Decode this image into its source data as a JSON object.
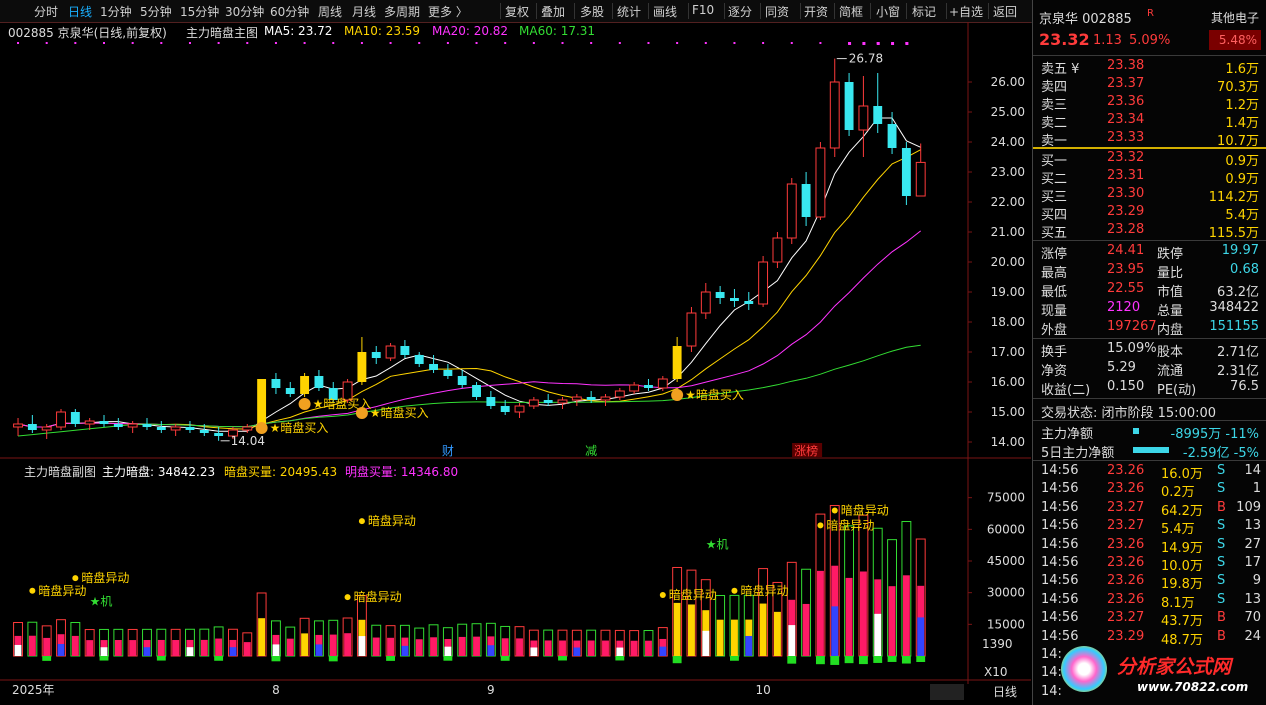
{
  "toolbar": {
    "items": [
      "分时",
      "日线",
      "1分钟",
      "5分钟",
      "15分钟",
      "30分钟",
      "60分钟",
      "周线",
      "月线",
      "多周期",
      "更多 〉",
      "复权",
      "叠加",
      "多股",
      "统计",
      "画线",
      "F10",
      "逐分",
      "同资",
      "开资",
      "简框",
      "小窗",
      "标记",
      "+自选",
      "返回"
    ],
    "active": "日线"
  },
  "main_chart": {
    "header": {
      "code_name": "002885 京泉华(日线,前复权)",
      "indicator": "主力暗盘主图",
      "ma5": "MA5: 23.72",
      "ma10": "MA10: 23.59",
      "ma20": "MA20: 20.82",
      "ma60": "MA60: 17.31"
    },
    "high_label": "26.78",
    "low_label": "14.04",
    "buy_signal_text": "★暗盘买入",
    "event_tags": [
      "财",
      "减",
      "涨榜"
    ],
    "y_ticks": [
      "26.00",
      "25.00",
      "24.00",
      "23.00",
      "22.00",
      "21.00",
      "20.00",
      "19.00",
      "18.00",
      "17.00",
      "16.00",
      "15.00",
      "14.00"
    ]
  },
  "sub_chart": {
    "indicator": "主力暗盘副图",
    "main_value": "主力暗盘: 34842.23",
    "dark_buy": "暗盘买量: 20495.43",
    "bright_buy": "明盘买量: 14346.80",
    "anomaly_text": "暗盘异动",
    "machine_text": "★机",
    "y_ticks": [
      "75000",
      "60000",
      "45000",
      "30000",
      "15000"
    ],
    "vol_box": "1390",
    "x10": "X10"
  },
  "x_axis": {
    "labels": [
      "2025年",
      "8",
      "9",
      "10"
    ],
    "bottom_right": "日线"
  },
  "chart_data": {
    "type": "candlestick",
    "title": "002885 京泉华(日线,前复权)",
    "ylim": [
      13.6,
      27.2
    ],
    "x_labels": [
      "2025年",
      "8",
      "9",
      "10"
    ],
    "ohlc": [
      [
        14.5,
        14.8,
        14.2,
        14.6
      ],
      [
        14.6,
        14.9,
        14.3,
        14.4
      ],
      [
        14.4,
        14.6,
        14.1,
        14.5
      ],
      [
        14.5,
        15.1,
        14.4,
        15.0
      ],
      [
        15.0,
        15.1,
        14.5,
        14.6
      ],
      [
        14.6,
        14.8,
        14.4,
        14.7
      ],
      [
        14.7,
        14.9,
        14.5,
        14.6
      ],
      [
        14.6,
        14.8,
        14.4,
        14.5
      ],
      [
        14.5,
        14.7,
        14.3,
        14.6
      ],
      [
        14.6,
        14.8,
        14.4,
        14.5
      ],
      [
        14.5,
        14.7,
        14.3,
        14.4
      ],
      [
        14.4,
        14.6,
        14.2,
        14.5
      ],
      [
        14.5,
        14.7,
        14.3,
        14.4
      ],
      [
        14.4,
        14.6,
        14.2,
        14.3
      ],
      [
        14.3,
        14.5,
        14.04,
        14.2
      ],
      [
        14.2,
        14.5,
        14.1,
        14.4
      ],
      [
        14.4,
        14.6,
        14.3,
        14.5
      ],
      [
        14.5,
        16.1,
        14.5,
        16.1
      ],
      [
        16.1,
        16.3,
        15.6,
        15.8
      ],
      [
        15.8,
        16.0,
        15.5,
        15.6
      ],
      [
        15.6,
        16.3,
        15.5,
        16.2
      ],
      [
        16.2,
        16.4,
        15.7,
        15.8
      ],
      [
        15.8,
        16.0,
        15.3,
        15.4
      ],
      [
        15.4,
        16.1,
        15.3,
        16.0
      ],
      [
        16.0,
        17.5,
        15.9,
        17.0
      ],
      [
        17.0,
        17.2,
        16.6,
        16.8
      ],
      [
        16.8,
        17.3,
        16.7,
        17.2
      ],
      [
        17.2,
        17.4,
        16.8,
        16.9
      ],
      [
        16.9,
        17.0,
        16.5,
        16.6
      ],
      [
        16.6,
        16.9,
        16.3,
        16.4
      ],
      [
        16.4,
        16.6,
        16.1,
        16.2
      ],
      [
        16.2,
        16.4,
        15.8,
        15.9
      ],
      [
        15.9,
        16.0,
        15.4,
        15.5
      ],
      [
        15.5,
        15.7,
        15.1,
        15.2
      ],
      [
        15.2,
        15.4,
        14.9,
        15.0
      ],
      [
        15.0,
        15.3,
        14.8,
        15.2
      ],
      [
        15.2,
        15.5,
        15.1,
        15.4
      ],
      [
        15.4,
        15.6,
        15.2,
        15.3
      ],
      [
        15.3,
        15.5,
        15.1,
        15.4
      ],
      [
        15.4,
        15.6,
        15.2,
        15.5
      ],
      [
        15.5,
        15.7,
        15.3,
        15.4
      ],
      [
        15.4,
        15.6,
        15.2,
        15.5
      ],
      [
        15.5,
        15.8,
        15.4,
        15.7
      ],
      [
        15.7,
        16.0,
        15.6,
        15.9
      ],
      [
        15.9,
        16.1,
        15.7,
        15.8
      ],
      [
        15.8,
        16.2,
        15.7,
        16.1
      ],
      [
        16.1,
        17.5,
        16.0,
        17.2
      ],
      [
        17.2,
        18.5,
        17.0,
        18.3
      ],
      [
        18.3,
        19.3,
        18.1,
        19.0
      ],
      [
        19.0,
        19.2,
        18.6,
        18.8
      ],
      [
        18.8,
        19.1,
        18.5,
        18.7
      ],
      [
        18.7,
        19.0,
        18.4,
        18.6
      ],
      [
        18.6,
        20.2,
        18.5,
        20.0
      ],
      [
        20.0,
        21.0,
        19.8,
        20.8
      ],
      [
        20.8,
        22.8,
        20.6,
        22.6
      ],
      [
        22.6,
        23.0,
        21.2,
        21.5
      ],
      [
        21.5,
        24.0,
        21.4,
        23.8
      ],
      [
        23.8,
        26.78,
        23.5,
        26.0
      ],
      [
        26.0,
        26.3,
        24.2,
        24.4
      ],
      [
        24.4,
        26.2,
        23.5,
        25.2
      ],
      [
        25.2,
        26.3,
        24.3,
        24.6
      ],
      [
        24.6,
        25.0,
        23.6,
        23.8
      ],
      [
        23.8,
        24.0,
        21.9,
        22.2
      ],
      [
        22.2,
        23.95,
        22.55,
        23.32
      ]
    ],
    "ma": [
      {
        "name": "MA5",
        "last": 23.72
      },
      {
        "name": "MA10",
        "last": 23.59
      },
      {
        "name": "MA20",
        "last": 20.82
      },
      {
        "name": "MA60",
        "last": 17.31
      }
    ]
  },
  "panel": {
    "name_code": "京泉华 002885",
    "r_badge": "R",
    "sector": "其他电子",
    "sector_pct": "5.48%",
    "price": "23.32",
    "change": "1.13",
    "change_pct": "5.09%",
    "asks": [
      {
        "label": "卖五 ¥",
        "price": "23.38",
        "vol": "1.6万"
      },
      {
        "label": "卖四",
        "price": "23.37",
        "vol": "70.3万"
      },
      {
        "label": "卖三",
        "price": "23.36",
        "vol": "1.2万"
      },
      {
        "label": "卖二",
        "price": "23.34",
        "vol": "1.4万"
      },
      {
        "label": "卖一",
        "price": "23.33",
        "vol": "10.7万"
      }
    ],
    "bids": [
      {
        "label": "买一",
        "price": "23.32",
        "vol": "0.9万"
      },
      {
        "label": "买二",
        "price": "23.31",
        "vol": "0.9万"
      },
      {
        "label": "买三",
        "price": "23.30",
        "vol": "114.2万"
      },
      {
        "label": "买四",
        "price": "23.29",
        "vol": "5.4万"
      },
      {
        "label": "买五",
        "price": "23.28",
        "vol": "115.5万"
      }
    ],
    "stats": [
      {
        "l1": "涨停",
        "v1": "24.41",
        "c1": "red",
        "l2": "跌停",
        "v2": "19.97",
        "c2": "green"
      },
      {
        "l1": "最高",
        "v1": "23.95",
        "c1": "red",
        "l2": "量比",
        "v2": "0.68",
        "c2": "green"
      },
      {
        "l1": "最低",
        "v1": "22.55",
        "c1": "red",
        "l2": "市值",
        "v2": "63.2亿",
        "c2": "white"
      },
      {
        "l1": "现量",
        "v1": "2120",
        "c1": "magenta",
        "l2": "总量",
        "v2": "348422",
        "c2": "white"
      },
      {
        "l1": "外盘",
        "v1": "197267",
        "c1": "red",
        "l2": "内盘",
        "v2": "151155",
        "c2": "green"
      }
    ],
    "stats2": [
      {
        "l1": "换手",
        "v1": "15.09%",
        "l2": "股本",
        "v2": "2.71亿"
      },
      {
        "l1": "净资",
        "v1": "5.29",
        "l2": "流通",
        "v2": "2.31亿"
      },
      {
        "l1": "收益(二)",
        "v1": "0.150",
        "l2": "PE(动)",
        "v2": "76.5"
      }
    ],
    "trade_status": "交易状态: 闭市阶段 15:00:00",
    "net_flow_label": "主力净额",
    "net_flow_value": "-8995万 -11%",
    "net_flow5_label": "5日主力净额",
    "net_flow5_value": "-2.59亿 -5%",
    "trades": [
      {
        "t": "14:56",
        "p": "23.26",
        "v": "16.0万",
        "s": "S",
        "n": "14"
      },
      {
        "t": "14:56",
        "p": "23.26",
        "v": "0.2万",
        "s": "S",
        "n": "1"
      },
      {
        "t": "14:56",
        "p": "23.27",
        "v": "64.2万",
        "s": "B",
        "n": "109"
      },
      {
        "t": "14:56",
        "p": "23.27",
        "v": "5.4万",
        "s": "S",
        "n": "13"
      },
      {
        "t": "14:56",
        "p": "23.26",
        "v": "14.9万",
        "s": "S",
        "n": "27"
      },
      {
        "t": "14:56",
        "p": "23.26",
        "v": "10.0万",
        "s": "S",
        "n": "17"
      },
      {
        "t": "14:56",
        "p": "23.26",
        "v": "19.8万",
        "s": "S",
        "n": "9"
      },
      {
        "t": "14:56",
        "p": "23.26",
        "v": "8.1万",
        "s": "S",
        "n": "13"
      },
      {
        "t": "14:56",
        "p": "23.27",
        "v": "43.7万",
        "s": "B",
        "n": "70"
      },
      {
        "t": "14:56",
        "p": "23.29",
        "v": "48.7万",
        "s": "B",
        "n": "24"
      },
      {
        "t": "14:",
        "p": "",
        "v": "",
        "s": "",
        "n": ""
      },
      {
        "t": "14:",
        "p": "",
        "v": "",
        "s": "",
        "n": ""
      },
      {
        "t": "14:",
        "p": "",
        "v": "",
        "s": "",
        "n": ""
      }
    ],
    "watermark_title": "分析家公式网",
    "watermark_url": "www.70822.com"
  }
}
